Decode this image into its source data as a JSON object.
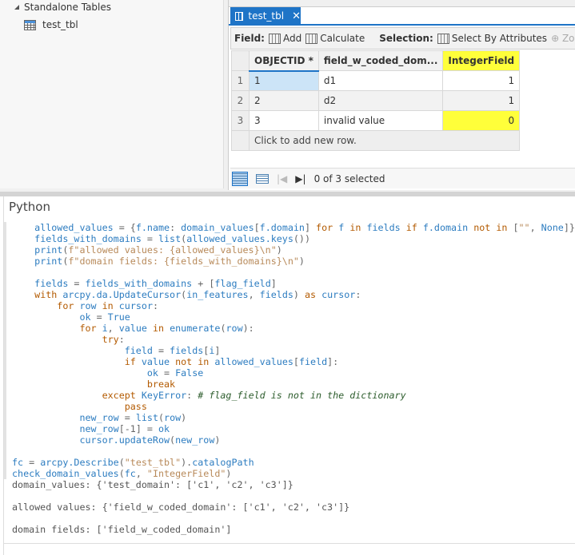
{
  "catalog": {
    "group": "Standalone Tables",
    "item": "test_tbl"
  },
  "tab": {
    "label": "test_tbl",
    "close": "✕"
  },
  "toolbar": {
    "field_label": "Field:",
    "add": "Add",
    "calculate": "Calculate",
    "selection_label": "Selection:",
    "select_by_attributes": "Select By Attributes",
    "zoom": "Zoom T"
  },
  "table": {
    "columns": [
      "OBJECTID *",
      "field_w_coded_dom...",
      "IntegerField"
    ],
    "rows": [
      {
        "n": "1",
        "id": "1",
        "f": "d1",
        "v": "1"
      },
      {
        "n": "2",
        "id": "2",
        "f": "d2",
        "v": "1"
      },
      {
        "n": "3",
        "id": "3",
        "f": "invalid value",
        "v": "0"
      }
    ],
    "add_row": "Click to add new row.",
    "highlight": "#ffff3a"
  },
  "status": {
    "selected": "0 of 3 selected"
  },
  "python": {
    "title": "Python",
    "input": [
      [
        [
          "p",
          "    "
        ],
        [
          "n",
          "allowed_values"
        ],
        [
          "p",
          " = {"
        ],
        [
          "n",
          "f.name"
        ],
        [
          "p",
          ": "
        ],
        [
          "n",
          "domain_values"
        ],
        [
          "p",
          "["
        ],
        [
          "n",
          "f.domain"
        ],
        [
          "p",
          "] "
        ],
        [
          "k",
          "for"
        ],
        [
          "p",
          " "
        ],
        [
          "n",
          "f"
        ],
        [
          "p",
          " "
        ],
        [
          "k",
          "in"
        ],
        [
          "p",
          " "
        ],
        [
          "n",
          "fields"
        ],
        [
          "p",
          " "
        ],
        [
          "k",
          "if"
        ],
        [
          "p",
          " "
        ],
        [
          "n",
          "f.domain"
        ],
        [
          "p",
          " "
        ],
        [
          "k",
          "not"
        ],
        [
          "p",
          " "
        ],
        [
          "k",
          "in"
        ],
        [
          "p",
          " ["
        ],
        [
          "s",
          "\"\""
        ],
        [
          "p",
          ", "
        ],
        [
          "n",
          "None"
        ],
        [
          "p",
          "]}"
        ]
      ],
      [
        [
          "p",
          "    "
        ],
        [
          "n",
          "fields_with_domains"
        ],
        [
          "p",
          " = "
        ],
        [
          "n",
          "list"
        ],
        [
          "p",
          "("
        ],
        [
          "n",
          "allowed_values.keys"
        ],
        [
          "p",
          "())"
        ]
      ],
      [
        [
          "p",
          "    "
        ],
        [
          "n",
          "print"
        ],
        [
          "p",
          "("
        ],
        [
          "s",
          "f\"allowed values: {allowed_values}\\n\""
        ],
        [
          "p",
          ")"
        ]
      ],
      [
        [
          "p",
          "    "
        ],
        [
          "n",
          "print"
        ],
        [
          "p",
          "("
        ],
        [
          "s",
          "f\"domain fields: {fields_with_domains}\\n\""
        ],
        [
          "p",
          ")"
        ]
      ],
      [],
      [
        [
          "p",
          "    "
        ],
        [
          "n",
          "fields"
        ],
        [
          "p",
          " = "
        ],
        [
          "n",
          "fields_with_domains"
        ],
        [
          "p",
          " + ["
        ],
        [
          "n",
          "flag_field"
        ],
        [
          "p",
          "]"
        ]
      ],
      [
        [
          "p",
          "    "
        ],
        [
          "k",
          "with"
        ],
        [
          "p",
          " "
        ],
        [
          "n",
          "arcpy.da.UpdateCursor"
        ],
        [
          "p",
          "("
        ],
        [
          "n",
          "in_features"
        ],
        [
          "p",
          ", "
        ],
        [
          "n",
          "fields"
        ],
        [
          "p",
          ") "
        ],
        [
          "k",
          "as"
        ],
        [
          "p",
          " "
        ],
        [
          "n",
          "cursor"
        ],
        [
          "p",
          ":"
        ]
      ],
      [
        [
          "p",
          "        "
        ],
        [
          "k",
          "for"
        ],
        [
          "p",
          " "
        ],
        [
          "n",
          "row"
        ],
        [
          "p",
          " "
        ],
        [
          "k",
          "in"
        ],
        [
          "p",
          " "
        ],
        [
          "n",
          "cursor"
        ],
        [
          "p",
          ":"
        ]
      ],
      [
        [
          "p",
          "            "
        ],
        [
          "n",
          "ok"
        ],
        [
          "p",
          " = "
        ],
        [
          "n",
          "True"
        ]
      ],
      [
        [
          "p",
          "            "
        ],
        [
          "k",
          "for"
        ],
        [
          "p",
          " "
        ],
        [
          "n",
          "i"
        ],
        [
          "p",
          ", "
        ],
        [
          "n",
          "value"
        ],
        [
          "p",
          " "
        ],
        [
          "k",
          "in"
        ],
        [
          "p",
          " "
        ],
        [
          "n",
          "enumerate"
        ],
        [
          "p",
          "("
        ],
        [
          "n",
          "row"
        ],
        [
          "p",
          "):"
        ]
      ],
      [
        [
          "p",
          "                "
        ],
        [
          "k",
          "try"
        ],
        [
          "p",
          ":"
        ]
      ],
      [
        [
          "p",
          "                    "
        ],
        [
          "n",
          "field"
        ],
        [
          "p",
          " = "
        ],
        [
          "n",
          "fields"
        ],
        [
          "p",
          "["
        ],
        [
          "n",
          "i"
        ],
        [
          "p",
          "]"
        ]
      ],
      [
        [
          "p",
          "                    "
        ],
        [
          "k",
          "if"
        ],
        [
          "p",
          " "
        ],
        [
          "n",
          "value"
        ],
        [
          "p",
          " "
        ],
        [
          "k",
          "not"
        ],
        [
          "p",
          " "
        ],
        [
          "k",
          "in"
        ],
        [
          "p",
          " "
        ],
        [
          "n",
          "allowed_values"
        ],
        [
          "p",
          "["
        ],
        [
          "n",
          "field"
        ],
        [
          "p",
          "]:"
        ]
      ],
      [
        [
          "p",
          "                        "
        ],
        [
          "n",
          "ok"
        ],
        [
          "p",
          " = "
        ],
        [
          "n",
          "False"
        ]
      ],
      [
        [
          "p",
          "                        "
        ],
        [
          "k",
          "break"
        ]
      ],
      [
        [
          "p",
          "                "
        ],
        [
          "k",
          "except"
        ],
        [
          "p",
          " "
        ],
        [
          "n",
          "KeyError"
        ],
        [
          "p",
          ": "
        ],
        [
          "c",
          "# flag_field is not in the dictionary"
        ]
      ],
      [
        [
          "p",
          "                    "
        ],
        [
          "k",
          "pass"
        ]
      ],
      [
        [
          "p",
          "            "
        ],
        [
          "n",
          "new_row"
        ],
        [
          "p",
          " = "
        ],
        [
          "n",
          "list"
        ],
        [
          "p",
          "("
        ],
        [
          "n",
          "row"
        ],
        [
          "p",
          ")"
        ]
      ],
      [
        [
          "p",
          "            "
        ],
        [
          "n",
          "new_row"
        ],
        [
          "p",
          "[-1] = "
        ],
        [
          "n",
          "ok"
        ]
      ],
      [
        [
          "p",
          "            "
        ],
        [
          "n",
          "cursor.updateRow"
        ],
        [
          "p",
          "("
        ],
        [
          "n",
          "new_row"
        ],
        [
          "p",
          ")"
        ]
      ],
      [],
      [
        [
          "n",
          "fc"
        ],
        [
          "p",
          " = "
        ],
        [
          "n",
          "arcpy.Describe"
        ],
        [
          "p",
          "("
        ],
        [
          "s",
          "\"test_tbl\""
        ],
        [
          "p",
          ")."
        ],
        [
          "n",
          "catalogPath"
        ]
      ],
      [
        [
          "n",
          "check_domain_values"
        ],
        [
          "p",
          "("
        ],
        [
          "n",
          "fc"
        ],
        [
          "p",
          ", "
        ],
        [
          "s",
          "\"IntegerField\""
        ],
        [
          "p",
          ")"
        ]
      ]
    ],
    "output": [
      "domain_values: {'test_domain': ['c1', 'c2', 'c3']}",
      "",
      "allowed values: {'field_w_coded_domain': ['c1', 'c2', 'c3']}",
      "",
      "domain fields: ['field_w_coded_domain']"
    ]
  }
}
